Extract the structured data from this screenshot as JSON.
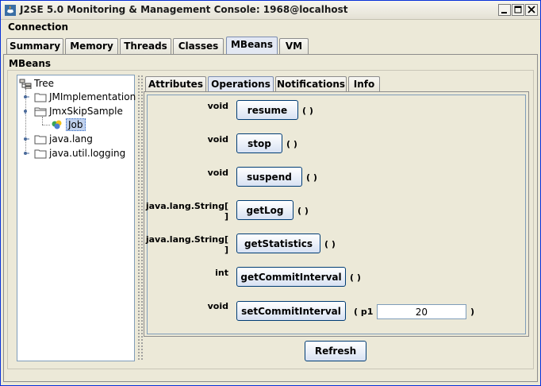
{
  "window": {
    "title": "J2SE 5.0 Monitoring & Management Console: 1968@localhost"
  },
  "menu": {
    "connection": "Connection"
  },
  "tabs": [
    {
      "label": "Summary"
    },
    {
      "label": "Memory"
    },
    {
      "label": "Threads"
    },
    {
      "label": "Classes"
    },
    {
      "label": "MBeans",
      "active": true
    },
    {
      "label": "VM"
    }
  ],
  "mbeans": {
    "group_label": "MBeans",
    "tree": {
      "root": "Tree",
      "nodes": [
        "JMImplementation",
        "JmxSkipSample",
        "Job",
        "java.lang",
        "java.util.logging"
      ],
      "selected": "Job"
    },
    "inner_tabs": [
      {
        "label": "Attributes"
      },
      {
        "label": "Operations",
        "active": true
      },
      {
        "label": "Notifications"
      },
      {
        "label": "Info"
      }
    ],
    "operations": [
      {
        "return_type": "void",
        "name": "resume",
        "params": "( )"
      },
      {
        "return_type": "void",
        "name": "stop",
        "params": "( )"
      },
      {
        "return_type": "void",
        "name": "suspend",
        "params": "( )"
      },
      {
        "return_type": "java.lang.String[ ]",
        "name": "getLog",
        "params": "( )"
      },
      {
        "return_type": "java.lang.String[ ]",
        "name": "getStatistics",
        "params": "( )"
      },
      {
        "return_type": "int",
        "name": "getCommitInterval",
        "params": "( )"
      },
      {
        "return_type": "void",
        "name": "setCommitInterval",
        "param_open": "( p1",
        "param_value": "20",
        "param_close": ")"
      }
    ],
    "refresh_label": "Refresh"
  },
  "colors": {
    "selection": "#c1d2ee",
    "button_border": "#003c74",
    "frame_border": "#0831d9"
  }
}
